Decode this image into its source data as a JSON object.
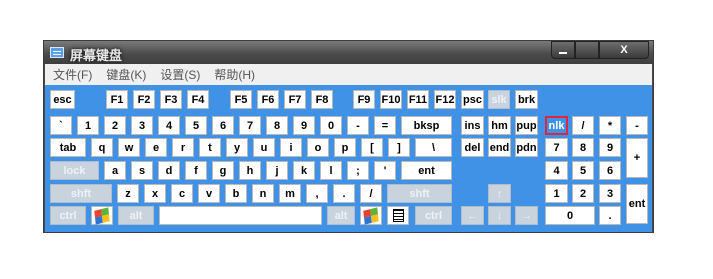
{
  "window": {
    "title": "屏幕键盘",
    "icon": "keyboard-app-icon",
    "controls": {
      "close_label": "X"
    }
  },
  "menu": [
    {
      "label": "文件(F)",
      "name": "menu-file"
    },
    {
      "label": "键盘(K)",
      "name": "menu-keyboard"
    },
    {
      "label": "设置(S)",
      "name": "menu-settings"
    },
    {
      "label": "帮助(H)",
      "name": "menu-help"
    }
  ],
  "colors": {
    "keyboard_bg": "#3f92e6",
    "key_bg": "#ffffff",
    "disabled_key": "#c9d3dd",
    "highlight_border": "#e0263a"
  },
  "rows": {
    "function": [
      "esc",
      "F1",
      "F2",
      "F3",
      "F4",
      "F5",
      "F6",
      "F7",
      "F8",
      "F9",
      "F10",
      "F11",
      "F12",
      "psc",
      "slk",
      "brk"
    ],
    "number": [
      "`",
      "1",
      "2",
      "3",
      "4",
      "5",
      "6",
      "7",
      "8",
      "9",
      "0",
      "-",
      "=",
      "bksp",
      "ins",
      "hm",
      "pup",
      "nlk",
      "/",
      "*",
      "-"
    ],
    "top": [
      "tab",
      "q",
      "w",
      "e",
      "r",
      "t",
      "y",
      "u",
      "i",
      "o",
      "p",
      "[",
      "]",
      "\\",
      "del",
      "end",
      "pdn",
      "7",
      "8",
      "9",
      "+"
    ],
    "home": [
      "lock",
      "a",
      "s",
      "d",
      "f",
      "g",
      "h",
      "j",
      "k",
      "l",
      ";",
      "'",
      "ent",
      "4",
      "5",
      "6"
    ],
    "shift": [
      "shft",
      "z",
      "x",
      "c",
      "v",
      "b",
      "n",
      "m",
      ",",
      ".",
      "/",
      "shft",
      "↑",
      "1",
      "2",
      "3",
      "ent"
    ],
    "bottom": [
      "ctrl",
      "windows-logo",
      "alt",
      "",
      "alt",
      "windows-logo",
      "menu-icon",
      "ctrl",
      "←",
      "↓",
      "→",
      "0",
      "."
    ]
  },
  "state": {
    "disabled": [
      "slk",
      "lock",
      "shft",
      "ctrl",
      "alt",
      "↑",
      "←",
      "↓",
      "→"
    ],
    "highlighted": [
      "nlk"
    ]
  }
}
